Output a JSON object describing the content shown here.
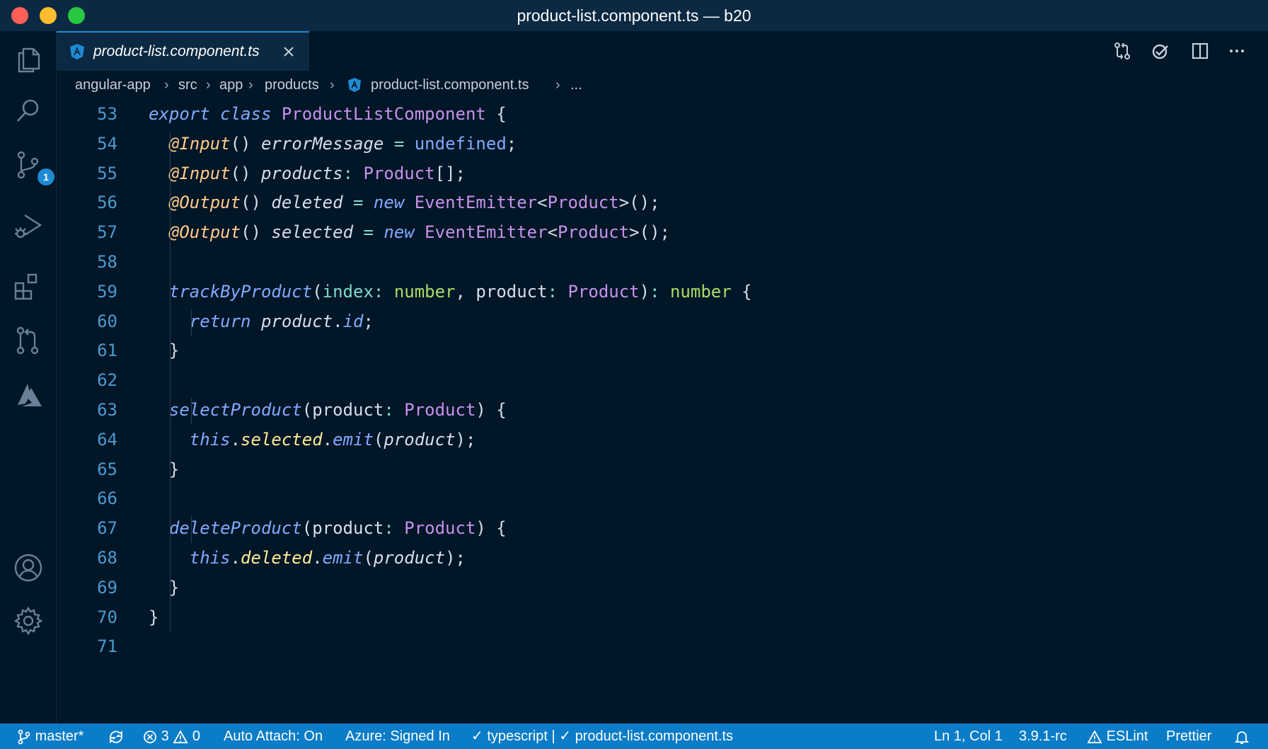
{
  "window": {
    "title": "product-list.component.ts — b20"
  },
  "tab": {
    "label": "product-list.component.ts"
  },
  "breadcrumb": [
    "angular-app",
    "src",
    "app",
    "products",
    "product-list.component.ts",
    "..."
  ],
  "activity": {
    "scm_badge": "1"
  },
  "code": {
    "lines": [
      {
        "n": "53",
        "tokens": [
          [
            "kw",
            "export "
          ],
          [
            "kw",
            "class "
          ],
          [
            "cls2",
            "ProductListComponent "
          ],
          [
            "pl",
            "{"
          ]
        ]
      },
      {
        "n": "54",
        "tokens": [
          [
            "pl",
            "  "
          ],
          [
            "dec",
            "@Input"
          ],
          [
            "pl",
            "() "
          ],
          [
            "prop",
            "errorMessage "
          ],
          [
            "op",
            "= "
          ],
          [
            "und",
            "undefined"
          ],
          [
            "pl",
            ";"
          ]
        ]
      },
      {
        "n": "55",
        "tokens": [
          [
            "pl",
            "  "
          ],
          [
            "dec",
            "@Input"
          ],
          [
            "pl",
            "() "
          ],
          [
            "prop",
            "products"
          ],
          [
            "op",
            ": "
          ],
          [
            "cls2",
            "Product"
          ],
          [
            "pl",
            "[];"
          ]
        ]
      },
      {
        "n": "56",
        "tokens": [
          [
            "pl",
            "  "
          ],
          [
            "dec",
            "@Output"
          ],
          [
            "pl",
            "() "
          ],
          [
            "prop",
            "deleted "
          ],
          [
            "op",
            "= "
          ],
          [
            "kw",
            "new "
          ],
          [
            "cls2",
            "EventEmitter"
          ],
          [
            "pl",
            "<"
          ],
          [
            "cls2",
            "Product"
          ],
          [
            "pl",
            ">();"
          ]
        ]
      },
      {
        "n": "57",
        "tokens": [
          [
            "pl",
            "  "
          ],
          [
            "dec",
            "@Output"
          ],
          [
            "pl",
            "() "
          ],
          [
            "prop",
            "selected "
          ],
          [
            "op",
            "= "
          ],
          [
            "kw",
            "new "
          ],
          [
            "cls2",
            "EventEmitter"
          ],
          [
            "pl",
            "<"
          ],
          [
            "cls2",
            "Product"
          ],
          [
            "pl",
            ">();"
          ]
        ]
      },
      {
        "n": "58",
        "tokens": []
      },
      {
        "n": "59",
        "tokens": [
          [
            "pl",
            "  "
          ],
          [
            "fn",
            "trackByProduct"
          ],
          [
            "pl",
            "("
          ],
          [
            "pmuted",
            "index"
          ],
          [
            "op",
            ": "
          ],
          [
            "typ",
            "number"
          ],
          [
            "pl",
            ", product"
          ],
          [
            "op",
            ": "
          ],
          [
            "cls2",
            "Product"
          ],
          [
            "pl",
            ")"
          ],
          [
            "op",
            ": "
          ],
          [
            "typ",
            "number "
          ],
          [
            "pl",
            "{"
          ]
        ]
      },
      {
        "n": "60",
        "tokens": [
          [
            "pl",
            "    "
          ],
          [
            "kw",
            "return "
          ],
          [
            "prop",
            "product"
          ],
          [
            "pl",
            "."
          ],
          [
            "fn",
            "id"
          ],
          [
            "pl",
            ";"
          ]
        ]
      },
      {
        "n": "61",
        "tokens": [
          [
            "pl",
            "  }"
          ]
        ]
      },
      {
        "n": "62",
        "tokens": []
      },
      {
        "n": "63",
        "tokens": [
          [
            "pl",
            "  "
          ],
          [
            "fn",
            "selectProduct"
          ],
          [
            "pl",
            "(product"
          ],
          [
            "op",
            ": "
          ],
          [
            "cls2",
            "Product"
          ],
          [
            "pl",
            ") {"
          ]
        ]
      },
      {
        "n": "64",
        "tokens": [
          [
            "pl",
            "    "
          ],
          [
            "this",
            "this"
          ],
          [
            "pl",
            "."
          ],
          [
            "emitp",
            "selected"
          ],
          [
            "pl",
            "."
          ],
          [
            "fn",
            "emit"
          ],
          [
            "pl",
            "("
          ],
          [
            "prop",
            "product"
          ],
          [
            "pl",
            ");"
          ]
        ]
      },
      {
        "n": "65",
        "tokens": [
          [
            "pl",
            "  }"
          ]
        ]
      },
      {
        "n": "66",
        "tokens": []
      },
      {
        "n": "67",
        "tokens": [
          [
            "pl",
            "  "
          ],
          [
            "fn",
            "deleteProduct"
          ],
          [
            "pl",
            "(product"
          ],
          [
            "op",
            ": "
          ],
          [
            "cls2",
            "Product"
          ],
          [
            "pl",
            ") {"
          ]
        ]
      },
      {
        "n": "68",
        "tokens": [
          [
            "pl",
            "    "
          ],
          [
            "this",
            "this"
          ],
          [
            "pl",
            "."
          ],
          [
            "emitp",
            "deleted"
          ],
          [
            "pl",
            "."
          ],
          [
            "fn",
            "emit"
          ],
          [
            "pl",
            "("
          ],
          [
            "prop",
            "product"
          ],
          [
            "pl",
            ");"
          ]
        ]
      },
      {
        "n": "69",
        "tokens": [
          [
            "pl",
            "  }"
          ]
        ]
      },
      {
        "n": "70",
        "tokens": [
          [
            "pl",
            "}"
          ]
        ]
      },
      {
        "n": "71",
        "tokens": []
      }
    ]
  },
  "status": {
    "branch": "master*",
    "errors": "3",
    "warnings": "0",
    "auto_attach": "Auto Attach: On",
    "azure": "Azure: Signed In",
    "ts_status": "typescript |",
    "file_status": "product-list.component.ts",
    "cursor": "Ln 1, Col 1",
    "version": "3.9.1-rc",
    "eslint": "ESLint",
    "prettier": "Prettier"
  },
  "colors": {
    "editor_bg": "#011627",
    "status_bg": "#0b7cc7",
    "accent": "#1f8ad2"
  }
}
